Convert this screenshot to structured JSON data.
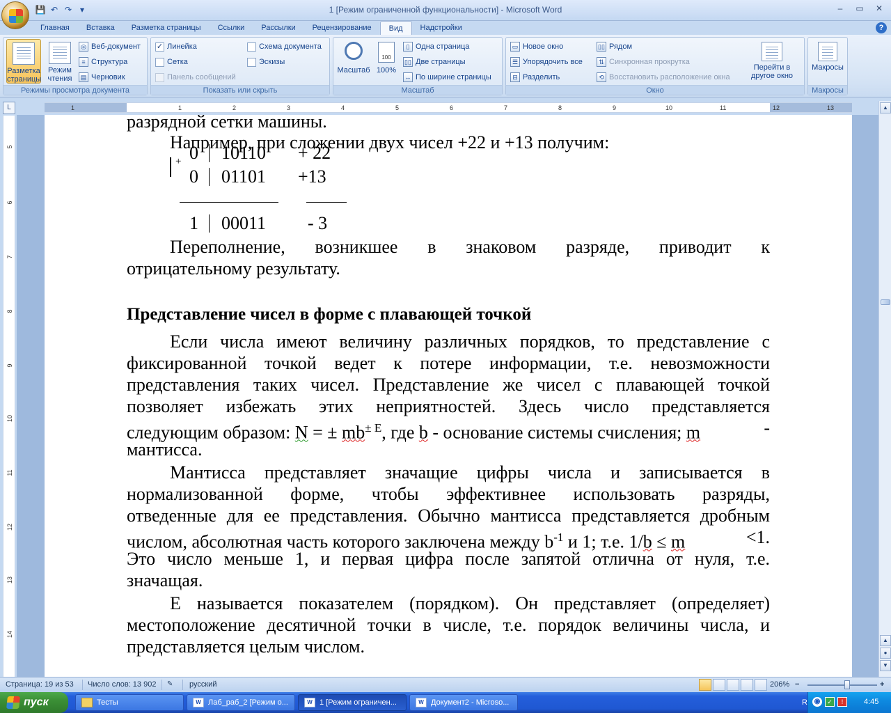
{
  "window": {
    "title": "1 [Режим ограниченной функциональности] - Microsoft Word",
    "controls": {
      "minimize": "–",
      "restore": "▭",
      "close": "✕"
    }
  },
  "qat": {
    "save": "💾",
    "undo": "↶",
    "redo": "↷",
    "customize": "▾"
  },
  "tabs": [
    "Главная",
    "Вставка",
    "Разметка страницы",
    "Ссылки",
    "Рассылки",
    "Рецензирование",
    "Вид",
    "Надстройки"
  ],
  "active_tab": "Вид",
  "help": "?",
  "ribbon": {
    "doc_views": {
      "label": "Режимы просмотра документа",
      "print_layout": "Разметка страницы",
      "reading": "Режим чтения",
      "web": "Веб-документ",
      "outline": "Структура",
      "draft": "Черновик"
    },
    "show_hide": {
      "label": "Показать или скрыть",
      "ruler": "Линейка",
      "ruler_checked": "✓",
      "gridlines": "Сетка",
      "message_bar": "Панель сообщений",
      "doc_map": "Схема документа",
      "thumbnails": "Эскизы"
    },
    "zoom": {
      "label": "Масштаб",
      "zoom_btn": "Масштаб",
      "hundred": "100%",
      "one_page": "Одна страница",
      "two_pages": "Две страницы",
      "page_width": "По ширине страницы"
    },
    "window": {
      "label": "Окно",
      "new_window": "Новое окно",
      "arrange_all": "Упорядочить все",
      "split": "Разделить",
      "side_by_side": "Рядом",
      "sync_scroll": "Синхронная прокрутка",
      "reset_pos": "Восстановить расположение окна",
      "switch": "Перейти в другое окно"
    },
    "macros": {
      "label": "Макросы",
      "btn": "Макросы"
    }
  },
  "ruler": {
    "h_ticks": [
      "1",
      "1",
      "2",
      "3",
      "4",
      "5",
      "6",
      "7",
      "8",
      "9",
      "10",
      "11",
      "12",
      "13"
    ],
    "v_ticks": [
      "5",
      "6",
      "7",
      "8",
      "9",
      "10",
      "11",
      "12",
      "13",
      "14"
    ],
    "corner": "L"
  },
  "document": {
    "top_partial": "разрядной сетки машины.",
    "example_line": "Например, при сложении двух чисел +22 и +13 получим:",
    "calc": {
      "plus": "+",
      "row1": {
        "sign": "0",
        "bits": "10110",
        "dec": "+ 22"
      },
      "row2": {
        "sign": "0",
        "bits": "01101",
        "dec": "+13"
      },
      "row3": {
        "sign": "1",
        "bits": "00011",
        "dec": "- 3"
      }
    },
    "overflow_1": "Переполнение, возникшее в знаковом разряде, приводит к",
    "overflow_2": "отрицательному результату.",
    "heading": "Представление чисел в форме с плавающей точкой",
    "p1": [
      "Если числа имеют величину различных порядков, то представление с",
      "фиксированной точкой ведет к потере информации, т.е. невозможности",
      "представления таких чисел. Представление же чисел с плавающей точкой",
      "позволяет избежать этих неприятностей. Здесь число представляется"
    ],
    "p1_formula": {
      "before": "следующим образом: ",
      "n": "N",
      "eq": "  = ± ",
      "mb": "mb",
      "exp": "± E",
      "mid": ", где ",
      "b": "b",
      "after": " - основание системы счисления; ",
      "m": "m",
      "end": " -"
    },
    "p1_last": "мантисса.",
    "p2": [
      "Мантисса представляет значащие цифры числа и записывается в",
      "нормализованной форме, чтобы эффективнее использовать разряды,",
      "отведенные для ее представления. Обычно мантисса представляется дробным"
    ],
    "p2_formula": {
      "before": "числом, абсолютная часть которого заключена между b",
      "exp": "-1",
      "mid": "  и 1; т.е. 1/",
      "b": "b",
      "le": " ≤ ",
      "m": "m",
      "end": " <1."
    },
    "p2_tail": [
      "Это число меньше 1, и первая цифра после запятой отлична от нуля, т.е.",
      "значащая."
    ],
    "p3": [
      "Е называется показателем (порядком). Он представляет (определяет)",
      "местоположение десятичной точки в числе, т.е. порядок величины числа, и",
      "представляется целым числом."
    ]
  },
  "statusbar": {
    "page": "Страница: 19 из 53",
    "words": "Число слов: 13 902",
    "lang": "русский",
    "zoom": "206%",
    "zoom_minus": "−",
    "zoom_plus": "+"
  },
  "taskbar": {
    "start": "пуск",
    "tasks": [
      "Тесты",
      "Лаб_раб_2 [Режим о...",
      "1 [Режим ограничен...",
      "Документ2 - Microso..."
    ],
    "active_task": 2,
    "lang": "RU",
    "clock": "4:45"
  }
}
